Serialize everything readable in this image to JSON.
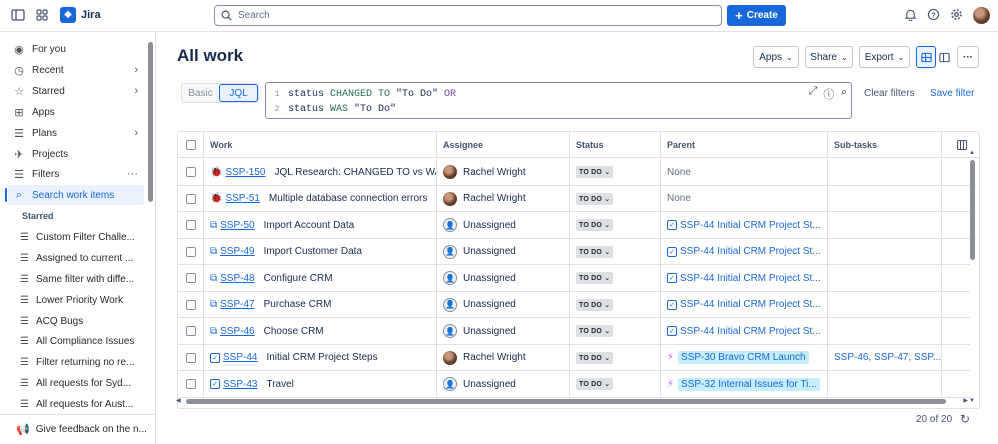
{
  "app": {
    "name": "Jira"
  },
  "search": {
    "placeholder": "Search"
  },
  "create_label": "Create",
  "sidebar": {
    "items": [
      {
        "label": "For you",
        "icon": "user-circle-icon",
        "chevron": false
      },
      {
        "label": "Recent",
        "icon": "clock-icon",
        "chevron": true
      },
      {
        "label": "Starred",
        "icon": "star-icon",
        "chevron": true
      },
      {
        "label": "Apps",
        "icon": "apps-icon",
        "chevron": false
      },
      {
        "label": "Plans",
        "icon": "plans-icon",
        "chevron": true
      },
      {
        "label": "Projects",
        "icon": "rocket-icon",
        "chevron": false
      },
      {
        "label": "Filters",
        "icon": "filter-icon",
        "chevron": false
      },
      {
        "label": "Search work items",
        "icon": "search-icon",
        "chevron": false,
        "active": true
      }
    ],
    "starred_heading": "Starred",
    "filters": [
      "Custom Filter Challe...",
      "Assigned to current ...",
      "Same filter with diffe...",
      "Lower Priority Work",
      "ACQ Bugs",
      "All Compliance Issues",
      "Filter returning no re...",
      "All requests for Syd...",
      "All requests for Aust..."
    ],
    "feedback": "Give feedback on the n..."
  },
  "page": {
    "title": "All work",
    "apps_label": "Apps",
    "share_label": "Share",
    "export_label": "Export"
  },
  "query": {
    "basic_label": "Basic",
    "jql_label": "JQL",
    "line1": {
      "field": "status ",
      "op": "CHANGED TO ",
      "value": "\"To Do\" ",
      "logic": "OR"
    },
    "line2": {
      "field": "status ",
      "op": "WAS ",
      "value": "\"To Do\""
    },
    "clear_label": "Clear filters",
    "save_label": "Save filter"
  },
  "table": {
    "columns": [
      "Work",
      "Assignee",
      "Status",
      "Parent",
      "Sub-tasks"
    ],
    "rows": [
      {
        "type": "bug",
        "key": "SSP-150",
        "summary": "JQL Research: CHANGED TO vs WA...",
        "assignee": "Rachel Wright",
        "assigned": true,
        "status": "TO DO",
        "parent": "None",
        "parent_kind": "none",
        "subtasks": ""
      },
      {
        "type": "bug",
        "key": "SSP-51",
        "summary": "Multiple database connection errors",
        "assignee": "Rachel Wright",
        "assigned": true,
        "status": "TO DO",
        "parent": "None",
        "parent_kind": "none",
        "subtasks": ""
      },
      {
        "type": "subtask",
        "key": "SSP-50",
        "summary": "Import Account Data",
        "assignee": "Unassigned",
        "assigned": false,
        "status": "TO DO",
        "parent": "SSP-44 Initial CRM Project St...",
        "parent_kind": "task",
        "subtasks": ""
      },
      {
        "type": "subtask",
        "key": "SSP-49",
        "summary": "Import Customer Data",
        "assignee": "Unassigned",
        "assigned": false,
        "status": "TO DO",
        "parent": "SSP-44 Initial CRM Project St...",
        "parent_kind": "task",
        "subtasks": ""
      },
      {
        "type": "subtask",
        "key": "SSP-48",
        "summary": "Configure CRM",
        "assignee": "Unassigned",
        "assigned": false,
        "status": "TO DO",
        "parent": "SSP-44 Initial CRM Project St...",
        "parent_kind": "task",
        "subtasks": ""
      },
      {
        "type": "subtask",
        "key": "SSP-47",
        "summary": "Purchase CRM",
        "assignee": "Unassigned",
        "assigned": false,
        "status": "TO DO",
        "parent": "SSP-44 Initial CRM Project St...",
        "parent_kind": "task",
        "subtasks": ""
      },
      {
        "type": "subtask",
        "key": "SSP-46",
        "summary": "Choose CRM",
        "assignee": "Unassigned",
        "assigned": false,
        "status": "TO DO",
        "parent": "SSP-44 Initial CRM Project St...",
        "parent_kind": "task",
        "subtasks": ""
      },
      {
        "type": "task",
        "key": "SSP-44",
        "summary": "Initial CRM Project Steps",
        "assignee": "Rachel Wright",
        "assigned": true,
        "status": "TO DO",
        "parent": "SSP-30 Bravo CRM Launch",
        "parent_kind": "epic",
        "subtasks": "SSP-46, SSP-47, SSP..."
      },
      {
        "type": "task",
        "key": "SSP-43",
        "summary": "Travel",
        "assignee": "Unassigned",
        "assigned": false,
        "status": "TO DO",
        "parent": "SSP-32 Internal Issues for Ti...",
        "parent_kind": "epic",
        "subtasks": ""
      }
    ]
  },
  "pagination": {
    "count": "20 of 20"
  },
  "colors": {
    "brand": "#1868db",
    "bug": "#e34935",
    "epic": "#bf63f3",
    "highlight": "#c6edfb"
  }
}
